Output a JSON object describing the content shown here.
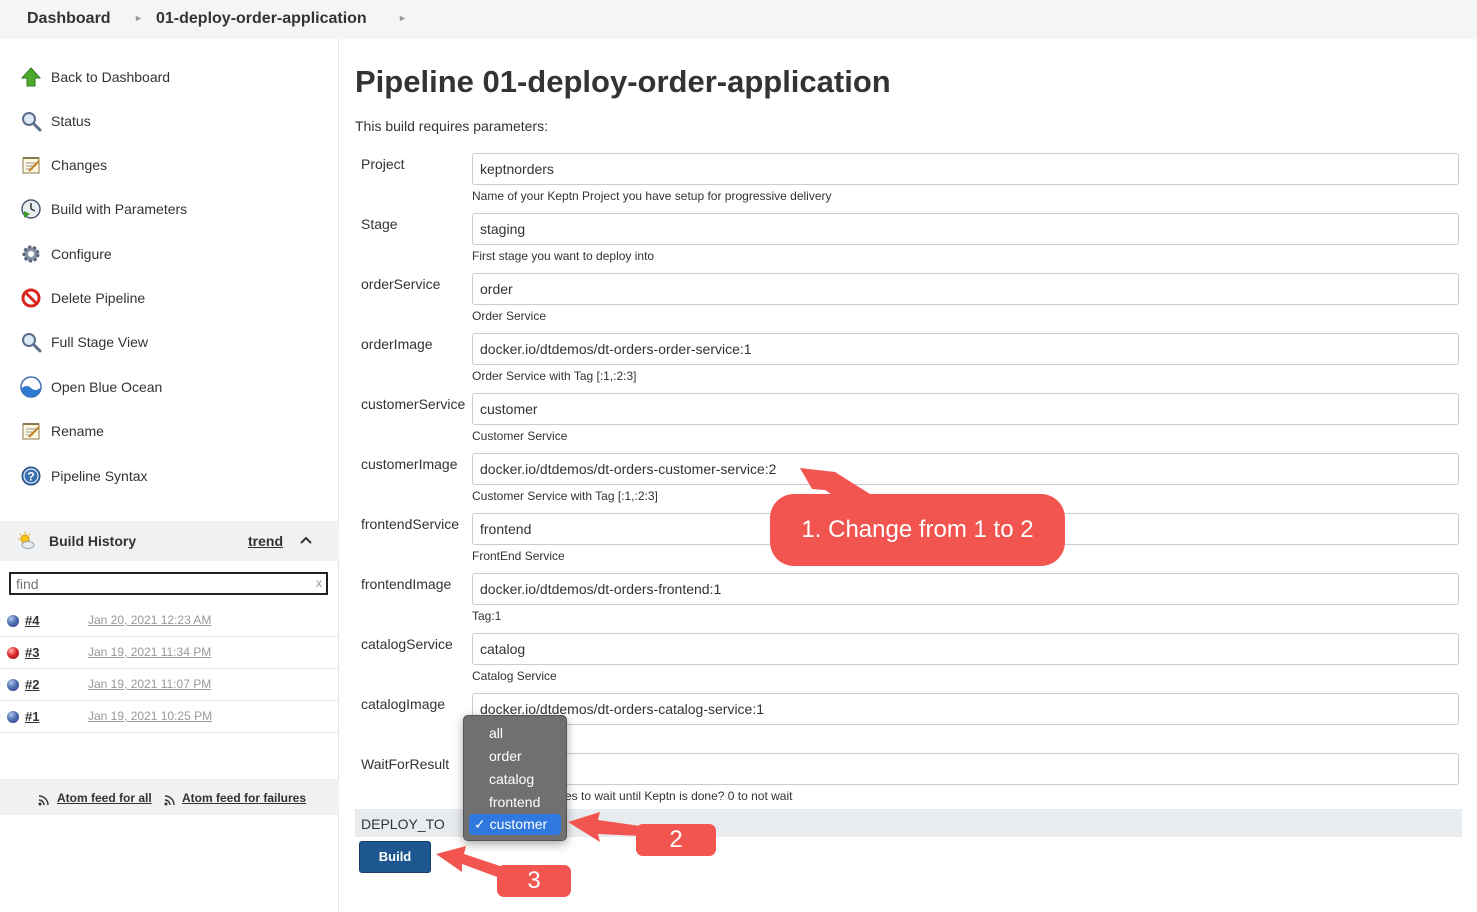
{
  "breadcrumb": {
    "dashboard": "Dashboard",
    "job": "01-deploy-order-application"
  },
  "sidebar": {
    "items": [
      {
        "label": "Back to Dashboard",
        "icon": "up-arrow-icon"
      },
      {
        "label": "Status",
        "icon": "magnifier-icon"
      },
      {
        "label": "Changes",
        "icon": "notepad-icon"
      },
      {
        "label": "Build with Parameters",
        "icon": "clock-play-icon"
      },
      {
        "label": "Configure",
        "icon": "gear-icon"
      },
      {
        "label": "Delete Pipeline",
        "icon": "no-entry-icon"
      },
      {
        "label": "Full Stage View",
        "icon": "magnifier-icon"
      },
      {
        "label": "Open Blue Ocean",
        "icon": "blue-ocean-icon"
      },
      {
        "label": "Rename",
        "icon": "notepad-icon"
      },
      {
        "label": "Pipeline Syntax",
        "icon": "help-icon"
      }
    ]
  },
  "build_history": {
    "title": "Build History",
    "trend": "trend",
    "find_placeholder": "find",
    "clear": "x",
    "builds": [
      {
        "num": "#4",
        "date": "Jan 20, 2021 12:23 AM",
        "status": "blue"
      },
      {
        "num": "#3",
        "date": "Jan 19, 2021 11:34 PM",
        "status": "red"
      },
      {
        "num": "#2",
        "date": "Jan 19, 2021 11:07 PM",
        "status": "blue"
      },
      {
        "num": "#1",
        "date": "Jan 19, 2021 10:25 PM",
        "status": "blue"
      }
    ],
    "feed_all": "Atom feed for all",
    "feed_failures": "Atom feed for failures"
  },
  "main": {
    "title": "Pipeline 01-deploy-order-application",
    "intro": "This build requires parameters:",
    "params": [
      {
        "label": "Project",
        "value": "keptnorders",
        "desc": "Name of your Keptn Project you have setup for progressive delivery"
      },
      {
        "label": "Stage",
        "value": "staging",
        "desc": "First stage you want to deploy into"
      },
      {
        "label": "orderService",
        "value": "order",
        "desc": "Order Service"
      },
      {
        "label": "orderImage",
        "value": "docker.io/dtdemos/dt-orders-order-service:1",
        "desc": "Order Service with Tag [:1,:2:3]"
      },
      {
        "label": "customerService",
        "value": "customer",
        "desc": "Customer Service"
      },
      {
        "label": "customerImage",
        "value": "docker.io/dtdemos/dt-orders-customer-service:2",
        "desc": "Customer Service with Tag [:1,:2:3]"
      },
      {
        "label": "frontendService",
        "value": "frontend",
        "desc": "FrontEnd Service"
      },
      {
        "label": "frontendImage",
        "value": "docker.io/dtdemos/dt-orders-frontend:1",
        "desc": "Tag:1"
      },
      {
        "label": "catalogService",
        "value": "catalog",
        "desc": "Catalog Service"
      },
      {
        "label": "catalogImage",
        "value": "docker.io/dtdemos/dt-orders-catalog-service:1",
        "desc": ""
      },
      {
        "label": "WaitForResult",
        "value": "",
        "desc": "es to wait until Keptn is done? 0 to not wait"
      }
    ],
    "deploy_to": {
      "label": "DEPLOY_TO",
      "options": [
        "all",
        "order",
        "catalog",
        "frontend",
        "customer"
      ],
      "selected": "customer",
      "check": "✓"
    },
    "build_button": "Build"
  },
  "annotations": {
    "callout1": "1.  Change from 1 to 2",
    "callout2": "2",
    "callout3": "3",
    "color": "#f25550"
  }
}
